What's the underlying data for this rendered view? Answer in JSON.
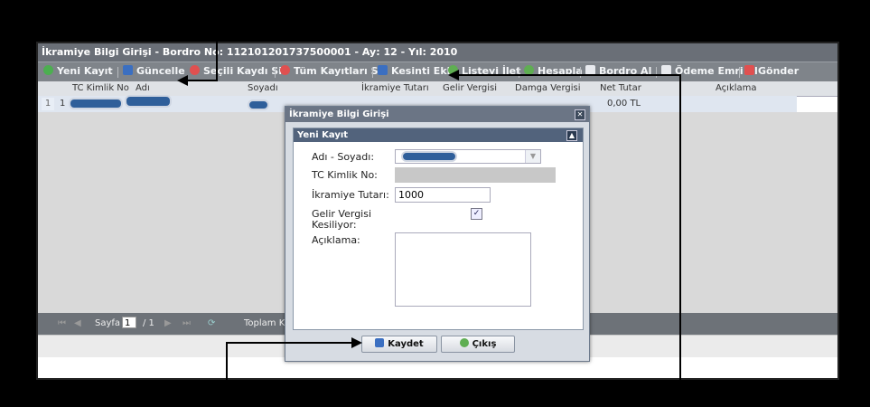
{
  "window": {
    "title": "İkramiye Bilgi Girişi - Bordro No: 112101201737500001 - Ay: 12 - Yıl: 2010"
  },
  "toolbar": {
    "new_record": "Yeni Kayıt",
    "update": "Güncelle",
    "delete_selected": "Seçili Kaydı Sil",
    "delete_all": "Tüm Kayıtları Sil",
    "add_deduction": "Kesinti Ekle",
    "print_list": "Listeyi İlet",
    "calculate": "Hesapla",
    "payroll": "Bordro Al",
    "payment_order": "Ödeme Emri Al",
    "send": "Gönder"
  },
  "grid": {
    "columns": [
      "TC Kimlik No",
      "Adı",
      "Soyadı",
      "İkramiye Tutarı",
      "Gelir Vergisi",
      "Damga Vergisi",
      "Net Tutar",
      "Açıklama"
    ],
    "rows": [
      {
        "num": "1",
        "tc": "1",
        "net": "0,00 TL"
      }
    ]
  },
  "pager": {
    "page_label": "Sayfa",
    "page_value": "1",
    "of_total": "/ 1",
    "total_label": "Toplam Kişi"
  },
  "dialog": {
    "title": "İkramiye Bilgi Girişi",
    "panel_title": "Yeni Kayıt",
    "name_label": "Adı - Soyadı:",
    "tc_label": "TC Kimlik No:",
    "bonus_label": "İkramiye Tutarı:",
    "bonus_value": "1000",
    "tax_label_line1": "Gelir Vergisi",
    "tax_label_line2": "Kesiliyor:",
    "tax_checked": true,
    "note_label": "Açıklama:",
    "save_label": "Kaydet",
    "exit_label": "Çıkış"
  }
}
